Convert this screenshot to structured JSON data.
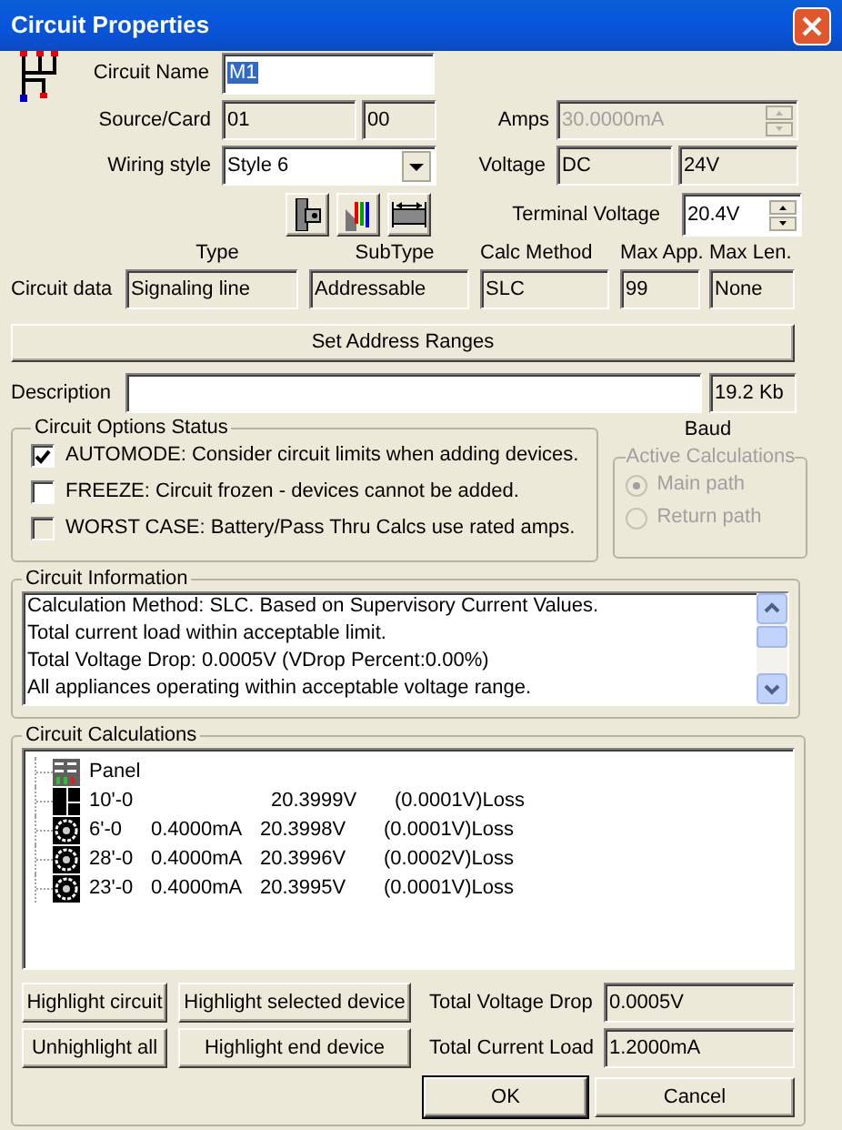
{
  "window": {
    "title": "Circuit Properties"
  },
  "circuit_name": {
    "label": "Circuit Name",
    "value": "M1",
    "selected": true
  },
  "source_card": {
    "label": "Source/Card",
    "values": [
      "01",
      "00"
    ]
  },
  "amps": {
    "label": "Amps",
    "value": "30.0000mA",
    "disabled": true
  },
  "wiring_style": {
    "label": "Wiring style",
    "value": "Style 6"
  },
  "voltage": {
    "label": "Voltage",
    "values": [
      "DC",
      "24V"
    ]
  },
  "terminal_voltage": {
    "label": "Terminal Voltage",
    "value": "20.4V"
  },
  "circuit_data": {
    "label": "Circuit data",
    "columns": [
      {
        "header": "Type",
        "value": "Signaling line"
      },
      {
        "header": "SubType",
        "value": "Addressable"
      },
      {
        "header": "Calc Method",
        "value": "SLC"
      },
      {
        "header": "Max App.",
        "value": "99"
      },
      {
        "header": "Max Len.",
        "value": "None"
      }
    ]
  },
  "set_address_button": {
    "label": "Set Address Ranges"
  },
  "description": {
    "label": "Description"
  },
  "baud": {
    "value": "19.2 Kb",
    "label": "Baud"
  },
  "circuit_options": {
    "title": "Circuit Options Status",
    "items": [
      {
        "label": "AUTOMODE: Consider circuit limits when adding devices.",
        "checked": true,
        "disabled": false
      },
      {
        "label": "FREEZE: Circuit frozen - devices cannot be added.",
        "checked": false,
        "disabled": false
      },
      {
        "label": "WORST CASE: Battery/Pass Thru Calcs use rated amps.",
        "checked": false,
        "disabled": true
      }
    ]
  },
  "active_calculations": {
    "title": "Active Calculations",
    "disabled": true,
    "items": [
      {
        "label": "Main path",
        "selected": true
      },
      {
        "label": "Return path",
        "selected": false
      }
    ]
  },
  "circuit_information": {
    "title": "Circuit Information",
    "lines": [
      "Calculation Method: SLC. Based on Supervisory Current Values.",
      "Total current load within acceptable limit.",
      "Total Voltage Drop: 0.0005V  (VDrop Percent:0.00%)",
      "All appliances operating within acceptable voltage range."
    ]
  },
  "circuit_calculations": {
    "title": "Circuit Calculations",
    "rows": [
      {
        "kind": "panel",
        "name": "Panel"
      },
      {
        "kind": "module",
        "name": "10'-0",
        "voltage": "20.3999V",
        "loss": "(0.0001V)Loss"
      },
      {
        "kind": "device",
        "name": "6'-0",
        "current": "0.4000mA",
        "voltage": "20.3998V",
        "loss": "(0.0001V)Loss"
      },
      {
        "kind": "device",
        "name": "28'-0",
        "current": "0.4000mA",
        "voltage": "20.3996V",
        "loss": "(0.0002V)Loss"
      },
      {
        "kind": "device",
        "name": "23'-0",
        "current": "0.4000mA",
        "voltage": "20.3995V",
        "loss": "(0.0001V)Loss"
      }
    ]
  },
  "highlight_buttons": [
    "Highlight circuit",
    "Highlight selected device",
    "Unhighlight all",
    "Highlight end device"
  ],
  "totals": [
    {
      "label": "Total Voltage Drop",
      "value": "0.0005V"
    },
    {
      "label": "Total Current Load",
      "value": "1.2000mA"
    }
  ],
  "dialog_buttons": [
    {
      "label": "OK",
      "default": true
    },
    {
      "label": "Cancel",
      "default": false
    }
  ]
}
